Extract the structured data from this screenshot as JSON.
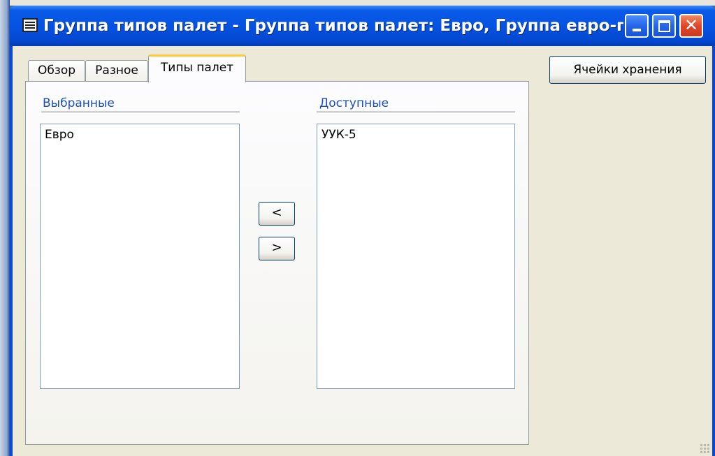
{
  "window": {
    "title": "Группа типов палет - Группа типов палет: Евро, Группа евро-пал..."
  },
  "tabs": [
    {
      "label": "Обзор",
      "active": false
    },
    {
      "label": "Разное",
      "active": false
    },
    {
      "label": "Типы палет",
      "active": true
    }
  ],
  "selected": {
    "label": "Выбранные",
    "items": [
      "Евро"
    ]
  },
  "available": {
    "label": "Доступные",
    "items": [
      "УУК-5"
    ]
  },
  "buttons": {
    "add": "<",
    "remove": ">",
    "storage_cells": "Ячейки хранения"
  },
  "icons": {
    "app": "app-window-icon",
    "minimize": "minimize-icon",
    "maximize": "maximize-icon",
    "close": "close-icon",
    "resize": "resize-grip-icon"
  },
  "colors": {
    "titlebar": "#0553e2",
    "close": "#e0472a",
    "client": "#ece9d8",
    "group_label": "#1a4fc2",
    "active_tab_highlight": "#ffc83c"
  }
}
